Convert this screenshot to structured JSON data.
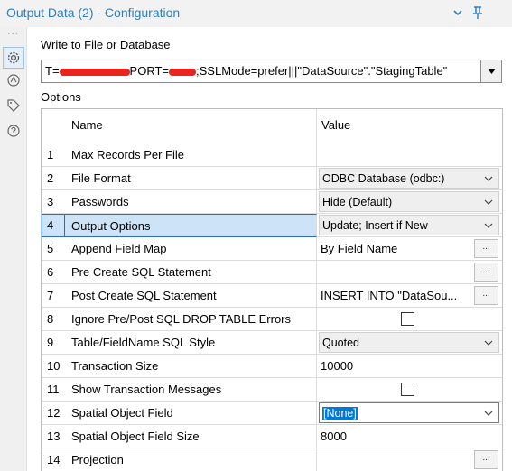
{
  "window": {
    "title": "Output Data (2) - Configuration"
  },
  "icons": {
    "titlebar": [
      "chevron-down-icon",
      "pin-icon"
    ],
    "sidebar": [
      "gear-icon",
      "compass-icon",
      "tag-icon",
      "help-icon"
    ]
  },
  "colors": {
    "title": "#2f7fbf",
    "selected_row": "#cde3f7",
    "selection_highlight": "#0078d7",
    "redaction": "#e8241f"
  },
  "write_section": {
    "label": "Write to File or Database",
    "connection_prefix": "T=",
    "connection_mid": "PORT=",
    "connection_suffix": ";SSLMode=prefer|||\"DataSource\".\"StagingTable\""
  },
  "options": {
    "label": "Options",
    "headers": {
      "name": "Name",
      "value": "Value"
    },
    "rows": [
      {
        "num": "1",
        "name": "Max Records Per File",
        "value": ""
      },
      {
        "num": "2",
        "name": "File Format",
        "value": "ODBC Database (odbc:)"
      },
      {
        "num": "3",
        "name": "Passwords",
        "value": "Hide (Default)"
      },
      {
        "num": "4",
        "name": "Output Options",
        "value": "Update; Insert if New"
      },
      {
        "num": "5",
        "name": "Append Field Map",
        "value": "By Field Name",
        "button": "..."
      },
      {
        "num": "6",
        "name": "Pre Create SQL Statement",
        "value": "",
        "button": "..."
      },
      {
        "num": "7",
        "name": "Post Create SQL Statement",
        "value": "INSERT INTO \"DataSou...",
        "button": "..."
      },
      {
        "num": "8",
        "name": "Ignore Pre/Post SQL DROP TABLE Errors",
        "checked": false
      },
      {
        "num": "9",
        "name": "Table/FieldName SQL Style",
        "value": "Quoted"
      },
      {
        "num": "10",
        "name": "Transaction Size",
        "value": "10000"
      },
      {
        "num": "11",
        "name": "Show Transaction Messages",
        "checked": false
      },
      {
        "num": "12",
        "name": "Spatial Object Field",
        "value": "[None]"
      },
      {
        "num": "13",
        "name": "Spatial Object Field Size",
        "value": "8000"
      },
      {
        "num": "14",
        "name": "Projection",
        "value": "",
        "button": "..."
      }
    ]
  }
}
